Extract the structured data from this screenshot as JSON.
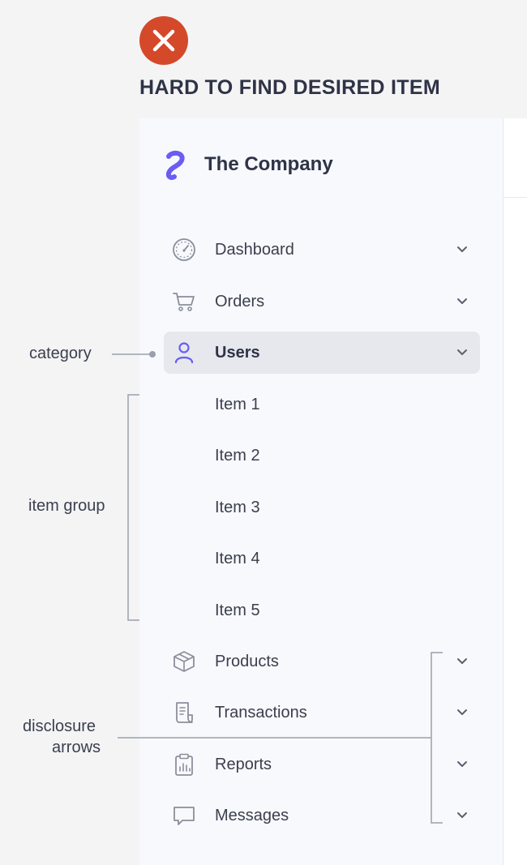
{
  "headline": "HARD TO FIND DESIRED ITEM",
  "colors": {
    "error_badge": "#d4492a",
    "brand_accent": "#6a5cf5",
    "active_bg": "#e6e8ee",
    "sidebar_bg": "#f7f9fc"
  },
  "sidebar": {
    "company_name": "The Company",
    "nav_items": [
      {
        "label": "Dashboard",
        "icon": "dashboard-gauge-icon"
      },
      {
        "label": "Orders",
        "icon": "cart-icon"
      },
      {
        "label": "Users",
        "icon": "user-icon",
        "active": true
      },
      {
        "label": "Products",
        "icon": "box-icon"
      },
      {
        "label": "Transactions",
        "icon": "receipt-icon"
      },
      {
        "label": "Reports",
        "icon": "clipboard-chart-icon"
      },
      {
        "label": "Messages",
        "icon": "chat-bubble-icon"
      }
    ],
    "sub_items": [
      "Item 1",
      "Item 2",
      "Item 3",
      "Item 4",
      "Item 5"
    ]
  },
  "annotations": {
    "category": "category",
    "item_group": "item group",
    "disclosure_line1": "disclosure",
    "disclosure_line2": "arrows"
  }
}
